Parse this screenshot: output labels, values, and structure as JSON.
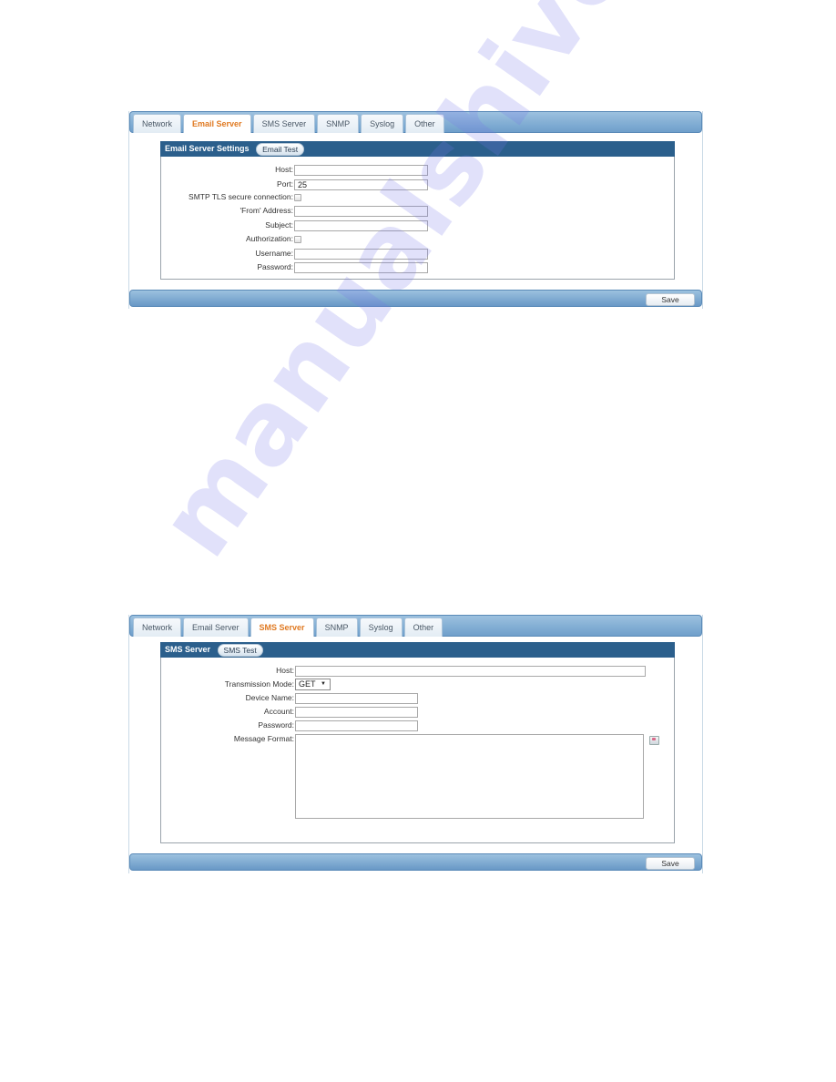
{
  "email_panel": {
    "tabs": [
      {
        "label": "Network",
        "active": false
      },
      {
        "label": "Email Server",
        "active": true
      },
      {
        "label": "SMS Server",
        "active": false
      },
      {
        "label": "SNMP",
        "active": false
      },
      {
        "label": "Syslog",
        "active": false
      },
      {
        "label": "Other",
        "active": false
      }
    ],
    "section_title": "Email Server Settings",
    "test_button": "Email Test",
    "fields": {
      "host": {
        "label": "Host:",
        "value": ""
      },
      "port": {
        "label": "Port:",
        "value": "25"
      },
      "smtp_tls": {
        "label": "SMTP TLS secure connection:",
        "checked": false
      },
      "from_address": {
        "label": "'From' Address:",
        "value": ""
      },
      "subject": {
        "label": "Subject:",
        "value": ""
      },
      "authorization": {
        "label": "Authorization:",
        "checked": false
      },
      "username": {
        "label": "Username:",
        "value": ""
      },
      "password": {
        "label": "Password:",
        "value": ""
      }
    },
    "save_label": "Save"
  },
  "sms_panel": {
    "tabs": [
      {
        "label": "Network",
        "active": false
      },
      {
        "label": "Email Server",
        "active": false
      },
      {
        "label": "SMS Server",
        "active": true
      },
      {
        "label": "SNMP",
        "active": false
      },
      {
        "label": "Syslog",
        "active": false
      },
      {
        "label": "Other",
        "active": false
      }
    ],
    "section_title": "SMS Server",
    "test_button": "SMS Test",
    "fields": {
      "host": {
        "label": "Host:",
        "value": ""
      },
      "transmission_mode": {
        "label": "Transmission Mode:",
        "value": "GET"
      },
      "device_name": {
        "label": "Device Name:",
        "value": ""
      },
      "account": {
        "label": "Account:",
        "value": ""
      },
      "password": {
        "label": "Password:",
        "value": ""
      },
      "message_format": {
        "label": "Message Format:",
        "value": ""
      }
    },
    "message_format_icon": "edit-icon",
    "save_label": "Save"
  },
  "watermark": "manualshive.com",
  "colors": {
    "active_tab_text": "#e07a22",
    "section_header": "#2b5f8c",
    "tabbar": "#7fabd3"
  }
}
